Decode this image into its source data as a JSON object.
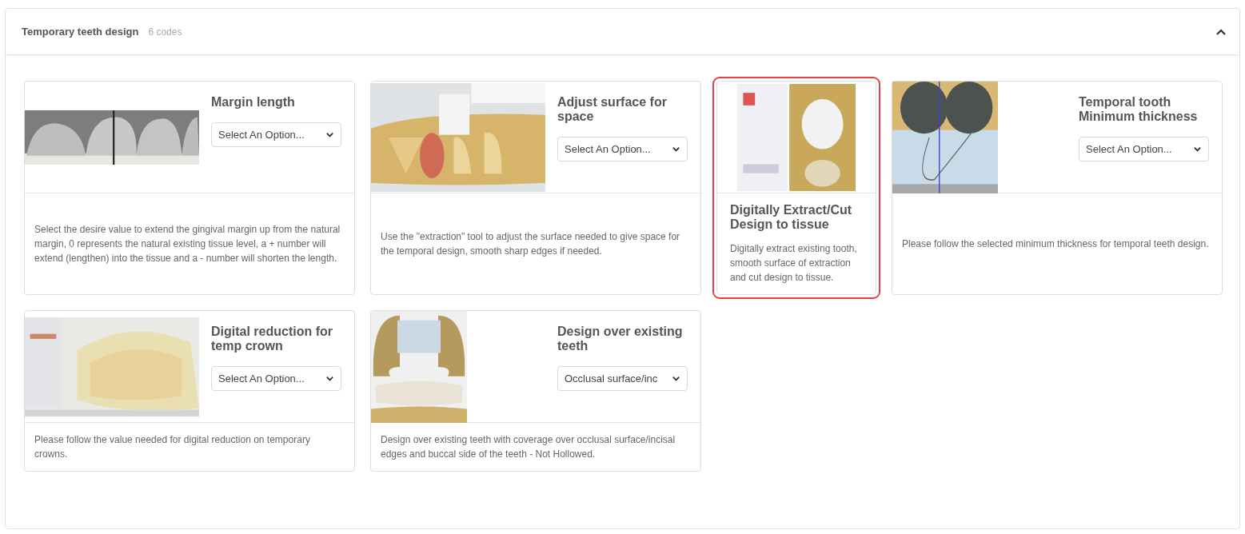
{
  "section": {
    "title": "Temporary teeth design",
    "count": "6 codes",
    "expanded": true
  },
  "cards": [
    {
      "kind": "option",
      "title": "Margin length",
      "dropdown": {
        "value": "Select An Option..."
      },
      "description": "Select the desire value to extend the gingival margin up from the natural margin, 0 represents the natural existing tissue level, a + number will extend (lengthen) into the tissue and a - number will shorten the length.",
      "selected": false
    },
    {
      "kind": "option",
      "title": "Adjust surface for space",
      "dropdown": {
        "value": "Select An Option..."
      },
      "description": "Use the \"extraction\" tool to adjust the surface needed to give space for the temporal design, smooth sharp edges if needed.",
      "selected": false
    },
    {
      "kind": "info",
      "title": "Digitally Extract/Cut Design to tissue",
      "description": "Digitally extract existing tooth, smooth surface of extraction and cut design to tissue.",
      "selected": true
    },
    {
      "kind": "option",
      "title": "Temporal tooth Minimum thickness",
      "dropdown": {
        "value": "Select An Option..."
      },
      "description": "Please follow the selected minimum thickness for temporal teeth design.",
      "selected": false
    },
    {
      "kind": "option",
      "title": "Digital reduction for temp crown",
      "dropdown": {
        "value": "Select An Option..."
      },
      "description": "Please follow the value needed for digital reduction on temporary crowns.",
      "selected": false
    },
    {
      "kind": "option",
      "title": "Design over existing teeth",
      "dropdown": {
        "value": "Occlusal surface/inc"
      },
      "description": "Design over existing teeth with coverage over occlusal surface/incisal edges and buccal side of the teeth - Not Hollowed.",
      "selected": false
    }
  ]
}
